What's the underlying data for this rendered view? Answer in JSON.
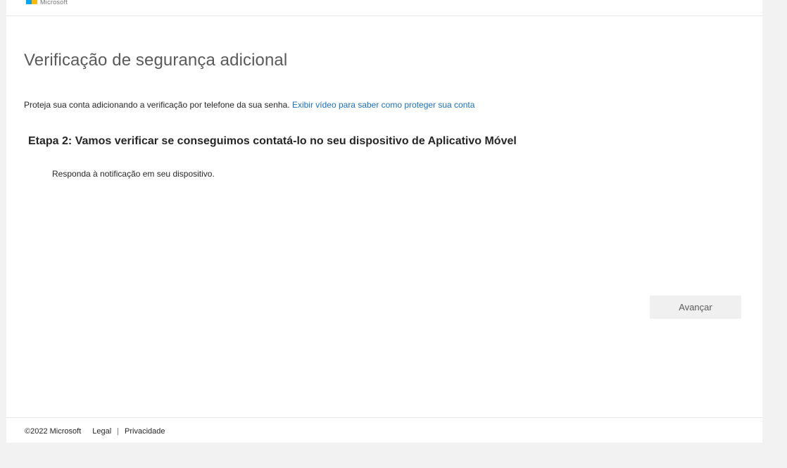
{
  "brand": {
    "logo_text": "Microsoft",
    "colors": {
      "blue": "#00a4ef",
      "yellow": "#ffb900"
    }
  },
  "page": {
    "title": "Verificação de segurança adicional",
    "intro_text": "Proteja sua conta adicionando a verificação por telefone da sua senha. ",
    "intro_link": "Exibir vídeo para saber como proteger sua conta",
    "step_heading": "Etapa 2: Vamos verificar se conseguimos contatá-lo no seu dispositivo de Aplicativo Móvel",
    "instruction": "Responda à notificação em seu dispositivo."
  },
  "actions": {
    "next_label": "Avançar"
  },
  "footer": {
    "copyright": "©2022 Microsoft",
    "legal_label": "Legal",
    "separator": "|",
    "privacy_label": "Privacidade"
  },
  "colors": {
    "link": "#1f6fb2",
    "background": "#f2f2f2",
    "card": "#ffffff",
    "button": "#f0f0f0"
  }
}
